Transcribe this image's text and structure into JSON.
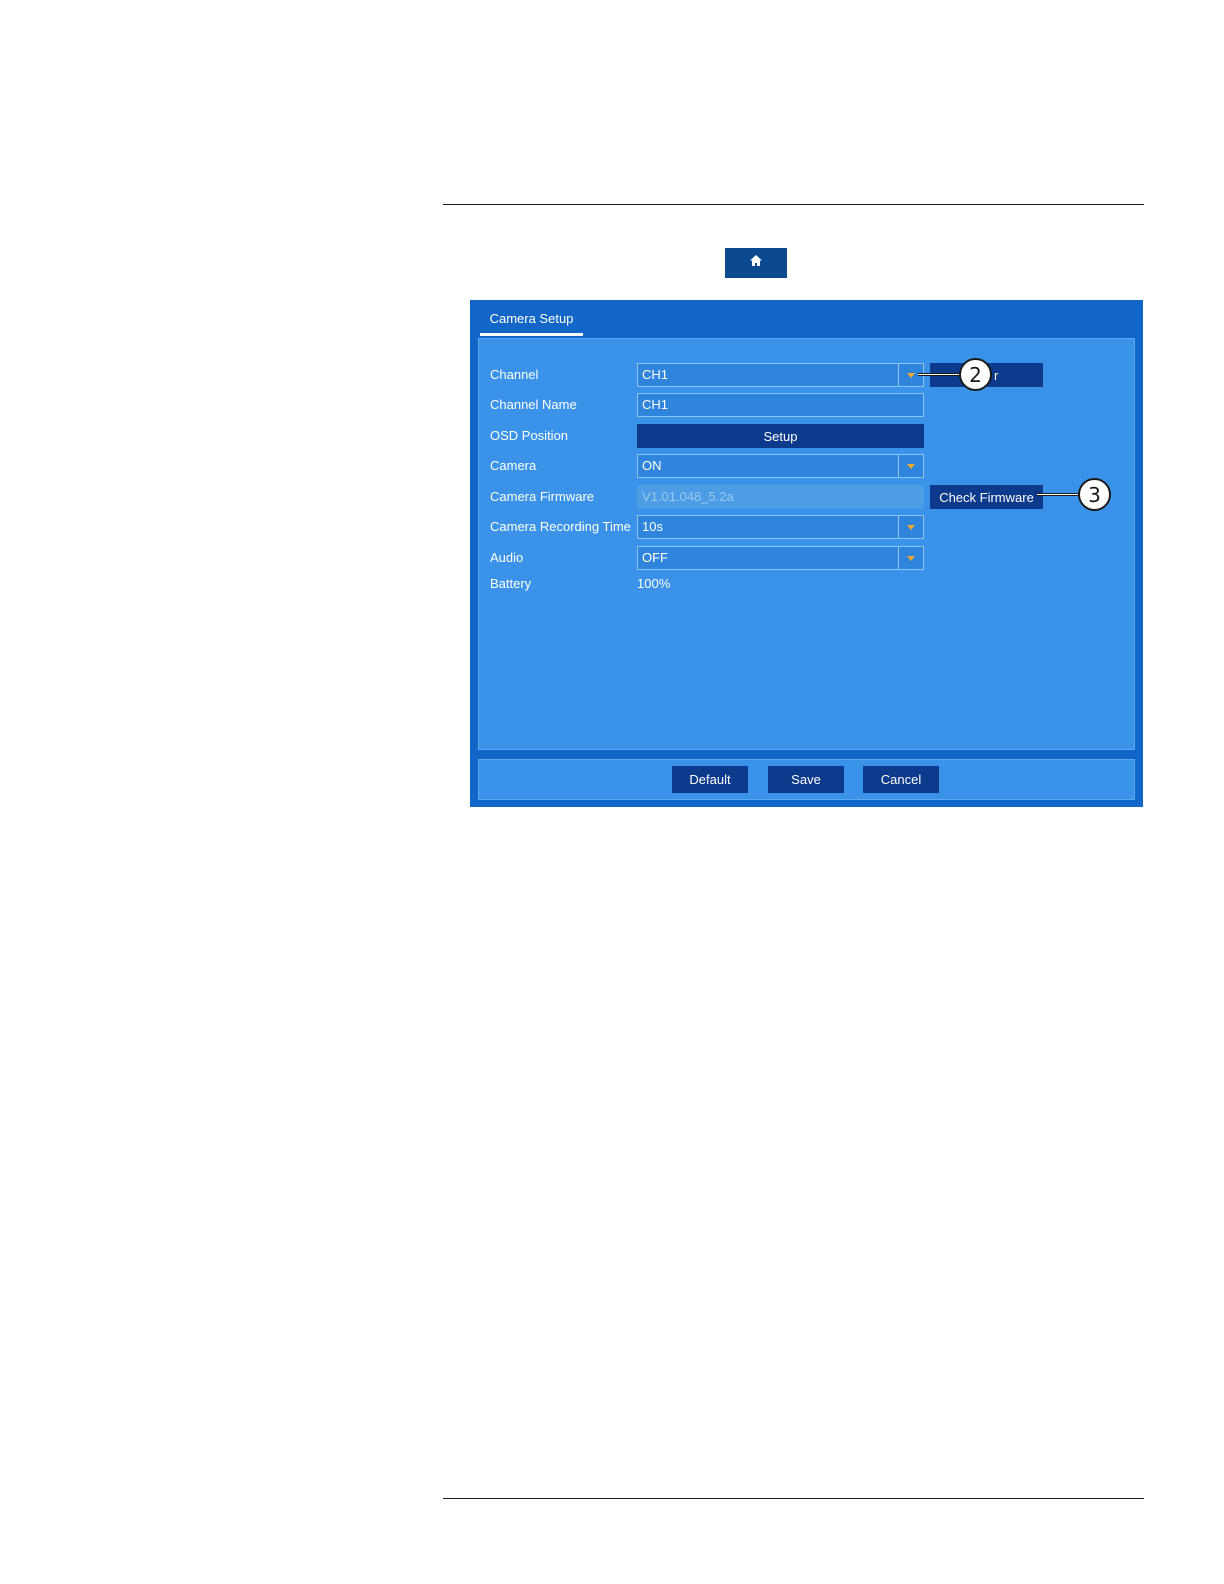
{
  "window": {
    "tab_label": "Camera Setup"
  },
  "form": {
    "channel": {
      "label": "Channel",
      "value": "CH1"
    },
    "channel_name": {
      "label": "Channel Name",
      "value": "CH1"
    },
    "osd_position": {
      "label": "OSD Position",
      "button_label": "Setup"
    },
    "camera": {
      "label": "Camera",
      "value": "ON"
    },
    "camera_firmware": {
      "label": "Camera Firmware",
      "value": "V1.01.048_5.2a",
      "button_label": "Check Firmware"
    },
    "camera_recording_time": {
      "label": "Camera Recording Time",
      "value": "10s"
    },
    "audio": {
      "label": "Audio",
      "value": "OFF"
    },
    "battery": {
      "label": "Battery",
      "value": "100%"
    },
    "partial_button_label": "r"
  },
  "footer": {
    "default_label": "Default",
    "save_label": "Save",
    "cancel_label": "Cancel"
  },
  "callouts": {
    "first": "2",
    "second": "3"
  },
  "colors": {
    "window_bg": "#1266c8",
    "panel_bg": "#3a93e8",
    "button_dark": "#0c3a8c",
    "dropdown_arrow": "#f2a82c"
  },
  "icons": {
    "home": "home-icon",
    "dropdown": "chevron-down-icon"
  }
}
